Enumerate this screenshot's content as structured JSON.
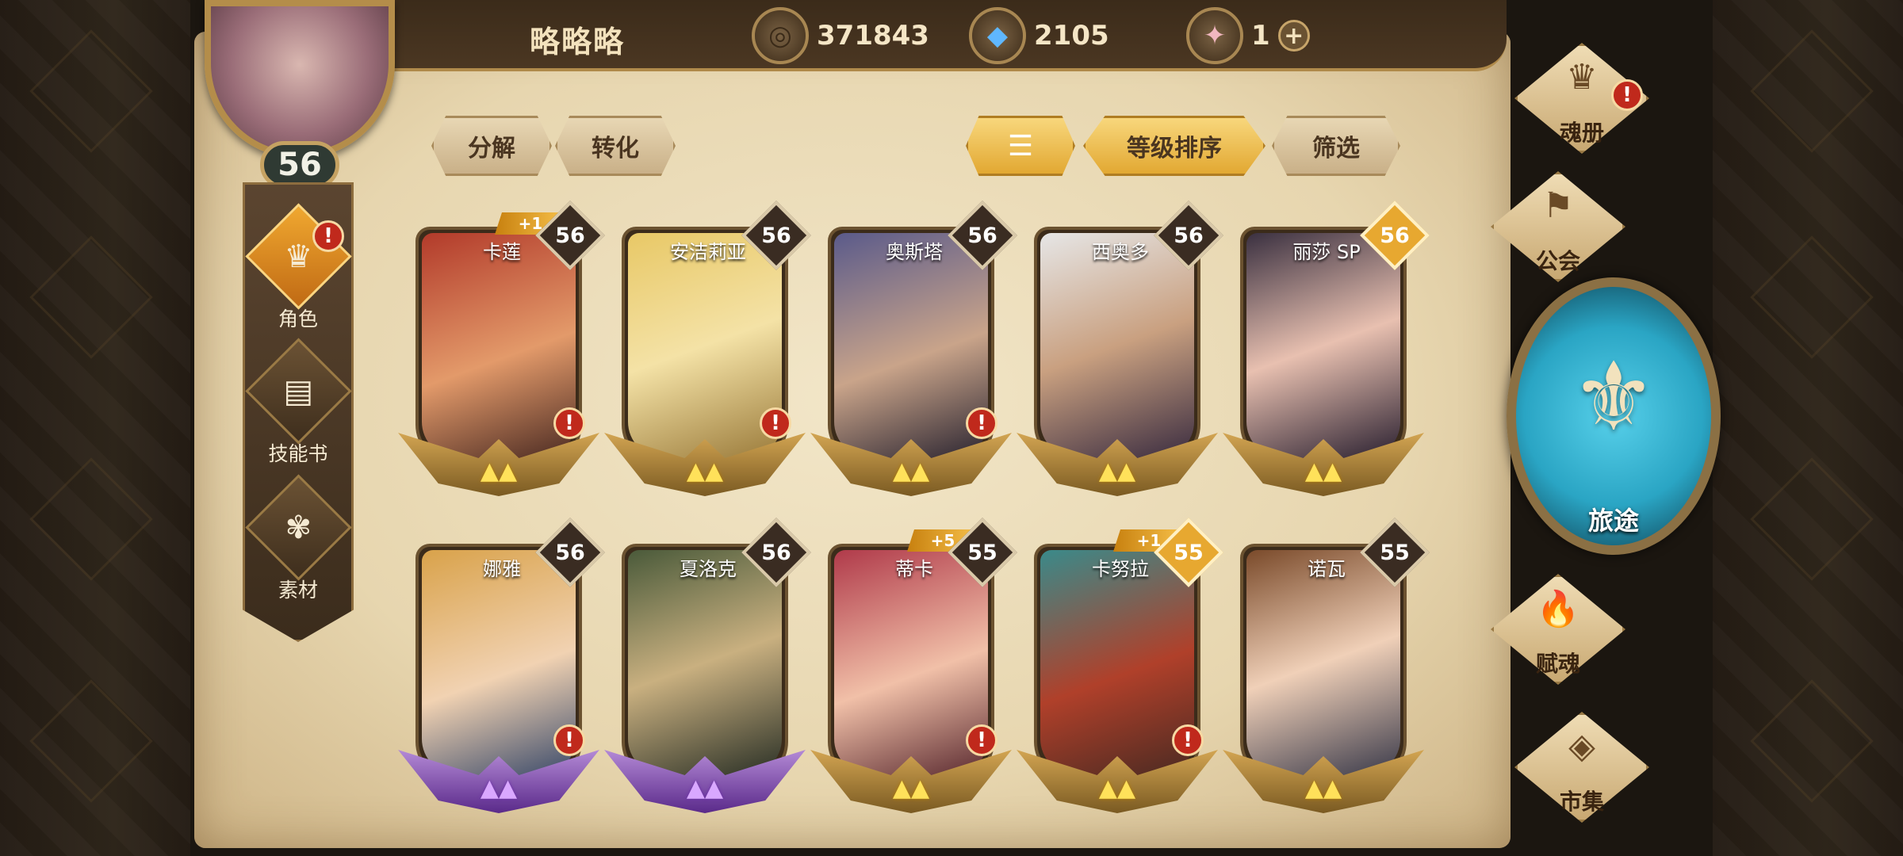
{
  "player": {
    "name": "略略略",
    "level": "56"
  },
  "resources": [
    {
      "icon": "gold-coin-icon",
      "value": "371843"
    },
    {
      "icon": "blue-crystal-icon",
      "value": "2105"
    },
    {
      "icon": "pink-gem-icon",
      "value": "1"
    }
  ],
  "toolbar": {
    "decompose": "分解",
    "convert": "转化",
    "sort_order_icon": "sort-icon",
    "sort_by_level": "等级排序",
    "filter": "筛选"
  },
  "left_nav": [
    {
      "label": "角色",
      "icon": "character-icon",
      "alert": "!"
    },
    {
      "label": "技能书",
      "icon": "skill-book-icon"
    },
    {
      "label": "素材",
      "icon": "material-icon"
    }
  ],
  "right_menu": {
    "soul_book": "魂册",
    "guild": "公会",
    "journey": "旅途",
    "soul_grant": "赋魂",
    "market": "市集",
    "alert": "!"
  },
  "cards": [
    {
      "name": "卡莲",
      "level": "56",
      "plus": "+1",
      "alert": "!"
    },
    {
      "name": "安洁莉亚",
      "level": "56",
      "alert": "!"
    },
    {
      "name": "奥斯塔",
      "level": "56",
      "alert": "!"
    },
    {
      "name": "西奥多",
      "level": "56"
    },
    {
      "name": "丽莎 SP",
      "level": "56"
    },
    {
      "name": "娜雅",
      "level": "56",
      "alert": "!"
    },
    {
      "name": "夏洛克",
      "level": "56"
    },
    {
      "name": "蒂卡",
      "level": "55",
      "plus": "+5",
      "alert": "!"
    },
    {
      "name": "卡努拉",
      "level": "55",
      "plus": "+1",
      "alert": "!"
    },
    {
      "name": "诺瓦",
      "level": "55"
    }
  ],
  "colors": {
    "parchment": "#e7d6af",
    "gold_accent": "#e2a832",
    "alert_red": "#c0291c",
    "journey_blue": "#2aa5c4"
  }
}
